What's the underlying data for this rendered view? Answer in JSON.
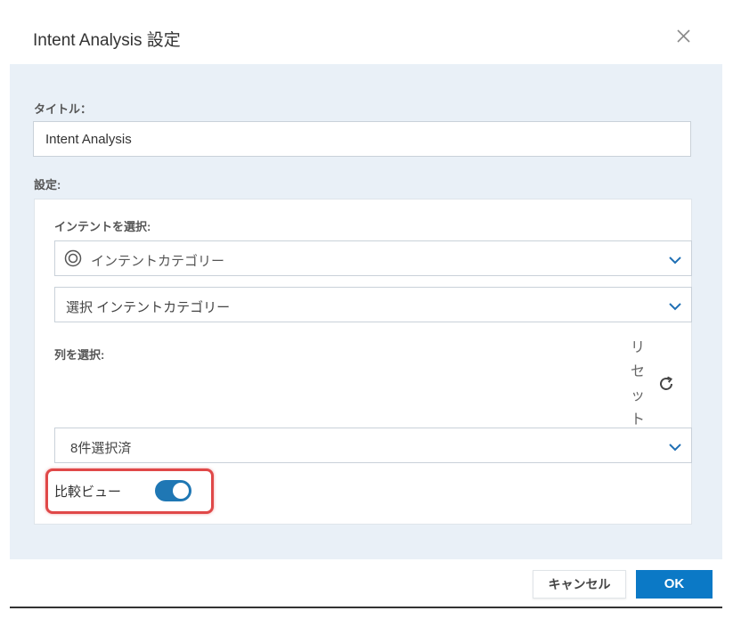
{
  "dialog": {
    "title": "Intent Analysis 設定",
    "close_icon": "close-icon"
  },
  "form": {
    "title_label": "タイトル：",
    "title_value": "Intent Analysis",
    "settings_label": "設定:",
    "intent_label": "インテントを選択:",
    "intent_type": {
      "icon": "target-icon",
      "value": "インテントカテゴリー"
    },
    "intent_category_select": "選択 インテントカテゴリー",
    "columns_label": "列を選択:",
    "reset_label": [
      "リ",
      "セ",
      "ッ",
      "ト"
    ],
    "reset_icon": "refresh-icon",
    "columns_select": "8件選択済",
    "compare_view": {
      "label": "比較ビュー",
      "enabled": true
    }
  },
  "footer": {
    "cancel_label": "キャンセル",
    "ok_label": "OK"
  },
  "colors": {
    "accent": "#0b79c6",
    "toggle_on": "#1f77b4",
    "body_bg": "#e9f0f7",
    "highlight": "#e04848"
  }
}
